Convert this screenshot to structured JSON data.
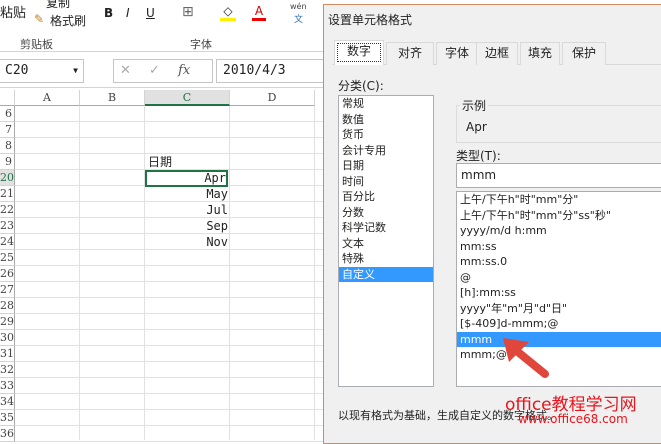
{
  "ribbon": {
    "paste": "粘贴",
    "copy": "复制",
    "format_painter": "格式刷",
    "clipboard_group": "剪贴板",
    "font_group": "字体",
    "bold": "B",
    "italic": "I",
    "underline": "U",
    "font_color": "A",
    "phonetic_top": "wén",
    "phonetic_bottom": "文"
  },
  "formula_bar": {
    "name_box": "C20",
    "fx": "fx",
    "value": "2010/4/3"
  },
  "sheet": {
    "columns": [
      "A",
      "B",
      "C",
      "D"
    ],
    "rows": [
      "6",
      "7",
      "8",
      "9",
      "20",
      "21",
      "22",
      "23",
      "24",
      "25",
      "26",
      "27",
      "28",
      "29",
      "30",
      "31",
      "32",
      "33",
      "34",
      "35",
      "36"
    ],
    "cells": {
      "header": "日期",
      "values": [
        "Apr",
        "May",
        "Jul",
        "Sep",
        "Nov"
      ]
    }
  },
  "dialog": {
    "title": "设置单元格格式",
    "tabs": [
      "数字",
      "对齐",
      "字体",
      "边框",
      "填充",
      "保护"
    ],
    "category_label": "分类(C):",
    "categories": [
      "常规",
      "数值",
      "货币",
      "会计专用",
      "日期",
      "时间",
      "百分比",
      "分数",
      "科学记数",
      "文本",
      "特殊",
      "自定义"
    ],
    "sample_label": "示例",
    "sample_value": "Apr",
    "type_label": "类型(T):",
    "type_value": "mmm",
    "formats": [
      "上午/下午h\"时\"mm\"分\"",
      "上午/下午h\"时\"mm\"分\"ss\"秒\"",
      "yyyy/m/d h:mm",
      "mm:ss",
      "mm:ss.0",
      "@",
      "[h]:mm:ss",
      "yyyy\"年\"m\"月\"d\"日\"",
      "[$-409]d-mmm;@",
      "mmm",
      "mmm;@"
    ],
    "footer": "以现有格式为基础，生成自定义的数字格式。"
  },
  "watermark": {
    "line1": "office教程学习网",
    "line2": "www.office68.com"
  },
  "colors": {
    "accent": "#3399ff",
    "arrow": "#e0463a",
    "watermark": "#e8141c"
  }
}
